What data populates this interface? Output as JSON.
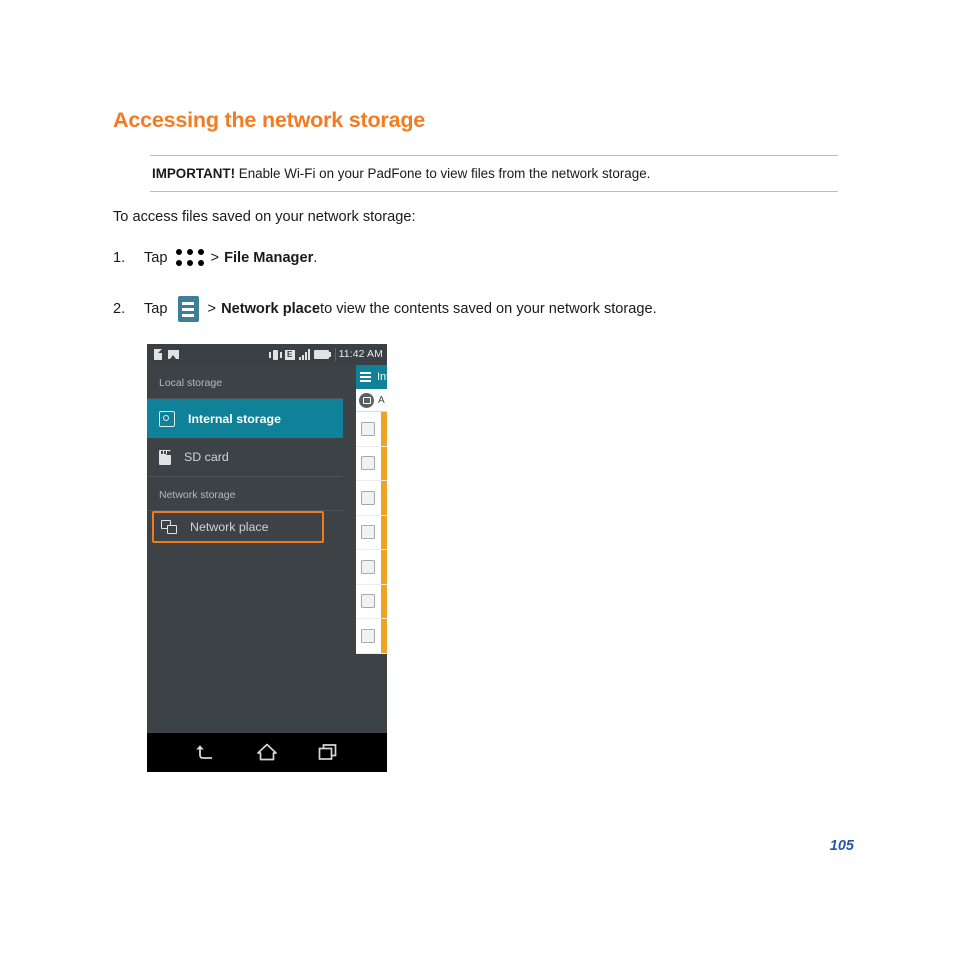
{
  "document": {
    "section_title": "Accessing the network storage",
    "page_number": "105"
  },
  "important_note": {
    "lead": "IMPORTANT!",
    "text": " Enable Wi-Fi on your PadFone to view files from the network storage."
  },
  "intro": "To access files saved on your network storage:",
  "steps": [
    {
      "number": "1.",
      "verb": "Tap",
      "icon": "app-grid-icon",
      "separator": ">",
      "target": "File Manager",
      "suffix": ".",
      "tail": ""
    },
    {
      "number": "2.",
      "verb": "Tap",
      "icon": "hamburger-menu-icon",
      "separator": ">",
      "target": "Network place",
      "suffix": "",
      "tail": " to view the contents saved on your network storage."
    }
  ],
  "phone": {
    "statusbar": {
      "left_icons": [
        "document-icon",
        "image-icon"
      ],
      "right_icons": [
        "vibrate-icon",
        "edge-network-icon",
        "signal-bars-icon",
        "battery-icon"
      ],
      "edge_label": "E",
      "time": "11:42 AM"
    },
    "drawer": {
      "groups": [
        {
          "label": "Local storage",
          "items": [
            {
              "label": "Internal storage",
              "icon": "internal-storage-icon",
              "selected": true,
              "highlighted": false
            },
            {
              "label": "SD card",
              "icon": "sd-card-icon",
              "selected": false,
              "highlighted": false
            }
          ]
        },
        {
          "label": "Network storage",
          "items": [
            {
              "label": "Network place",
              "icon": "network-place-icon",
              "selected": false,
              "highlighted": true
            }
          ]
        }
      ]
    },
    "content_panel": {
      "title": "Int",
      "path_label": "A",
      "row_count": 7
    },
    "navbar": {
      "buttons": [
        "back-icon",
        "home-icon",
        "recent-apps-icon"
      ]
    }
  },
  "colors": {
    "heading_orange": "#F47B20",
    "highlight_orange": "#F07B1D",
    "teal_selected": "#0f8199",
    "tile_blue": "#3d7f99",
    "accent_amber": "#EFA324",
    "page_number_blue": "#2A57A4"
  }
}
